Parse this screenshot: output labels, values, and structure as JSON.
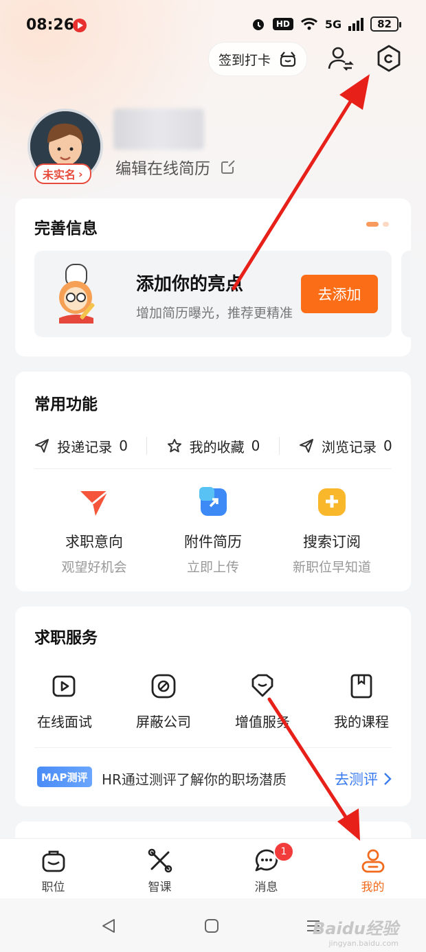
{
  "status_bar": {
    "time": "08:26",
    "hd": "HD",
    "network": "5G",
    "battery": "82"
  },
  "header": {
    "signin_label": "签到打卡"
  },
  "profile": {
    "verify_label": "未实名",
    "edit_resume_label": "编辑在线简历"
  },
  "complete_info": {
    "title": "完善信息",
    "add_title": "添加你的亮点",
    "add_subtitle": "增加简历曝光，推荐更精准",
    "add_button": "去添加"
  },
  "common_functions": {
    "title": "常用功能",
    "quick": [
      {
        "label": "投递记录",
        "count": "0",
        "icon": "paper-plane-icon"
      },
      {
        "label": "我的收藏",
        "count": "0",
        "icon": "star-icon"
      },
      {
        "label": "浏览记录",
        "count": "0",
        "icon": "paper-plane-icon"
      }
    ],
    "features": [
      {
        "name": "求职意向",
        "sub": "观望好机会",
        "icon": "job-intent-icon",
        "color": "#f4553b"
      },
      {
        "name": "附件简历",
        "sub": "立即上传",
        "icon": "attachment-resume-icon",
        "color": "#3d8af7"
      },
      {
        "name": "搜索订阅",
        "sub": "新职位早知道",
        "icon": "search-subscribe-icon",
        "color": "#f9b72c"
      }
    ]
  },
  "job_services": {
    "title": "求职服务",
    "items": [
      {
        "name": "在线面试",
        "icon": "video-interview-icon"
      },
      {
        "name": "屏蔽公司",
        "icon": "block-company-icon"
      },
      {
        "name": "增值服务",
        "icon": "value-added-icon"
      },
      {
        "name": "我的课程",
        "icon": "course-icon"
      }
    ],
    "map_tag": "MAP测评",
    "map_text": "HR通过测评了解你的职场潜质",
    "map_link": "去测评"
  },
  "tabbar": {
    "tabs": [
      {
        "label": "职位",
        "icon": "briefcase-icon"
      },
      {
        "label": "智课",
        "icon": "smart-course-icon"
      },
      {
        "label": "消息",
        "icon": "message-icon",
        "badge": "1"
      },
      {
        "label": "我的",
        "icon": "profile-icon",
        "active": true
      }
    ]
  },
  "system_nav": {
    "watermark": "Baidu经验",
    "watermark_sub": "jingyan.baidu.com"
  },
  "colors": {
    "accent": "#fb6e17",
    "link": "#3a7bf0",
    "badge": "#f23b3b",
    "annotation_arrow": "#e8201a"
  }
}
